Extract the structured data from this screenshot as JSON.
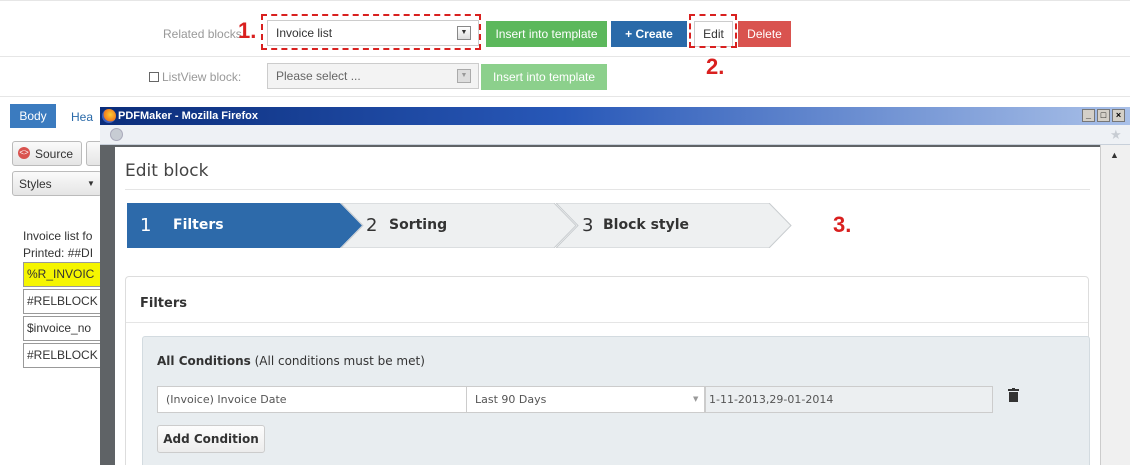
{
  "related_row": {
    "label": "Related blocks",
    "select_value": "Invoice list",
    "insert_button": "Insert into template",
    "create_button": "+ Create",
    "edit_button": "Edit",
    "delete_button": "Delete"
  },
  "listview_row": {
    "label": "ListView block:",
    "select_value": "Please select ...",
    "insert_button": "Insert into template"
  },
  "annotations": {
    "one": "1.",
    "two": "2.",
    "three": "3."
  },
  "editor": {
    "tab_body": "Body",
    "tab_header": "Hea",
    "source_button": "Source",
    "styles_dropdown": "Styles",
    "line1": "Invoice list fo",
    "line2": "Printed: ##DI",
    "cells": [
      "%R_INVOIC",
      "#RELBLOCK",
      "$invoice_no",
      "#RELBLOCK"
    ]
  },
  "popup": {
    "window_title": "PDFMaker - Mozilla Firefox",
    "modal_title": "Edit block",
    "steps": [
      {
        "num": "1",
        "label": "Filters"
      },
      {
        "num": "2",
        "label": "Sorting"
      },
      {
        "num": "3",
        "label": "Block style"
      }
    ],
    "panel_title": "Filters",
    "conditions_title": "All Conditions",
    "conditions_note": "(All conditions must be met)",
    "condition": {
      "field": "(Invoice) Invoice Date",
      "operator": "Last 90 Days",
      "value": "1-11-2013,29-01-2014"
    },
    "add_condition_button": "Add Condition"
  },
  "colors": {
    "annotation_red": "#d9201f",
    "green": "#5cb85c",
    "blue": "#2a6aa9",
    "red": "#d9534f",
    "active_step": "#2d6aaa"
  }
}
